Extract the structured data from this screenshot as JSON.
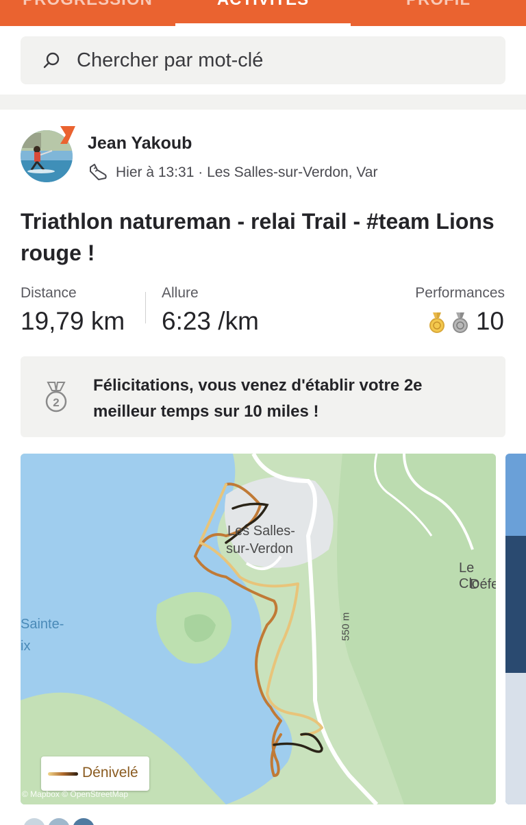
{
  "tabs": [
    "PROGRESSION",
    "ACTIVITÉS",
    "PROFIL"
  ],
  "search": {
    "placeholder": "Chercher par mot-clé",
    "icon": "search-icon"
  },
  "activity": {
    "athlete": "Jean Yakoub",
    "meta": "Hier à 13:31 · Les Salles-sur-Verdon, Var",
    "type_icon": "shoe-icon",
    "title": "Triathlon natureman - relai Trail - #team Lions rouge !",
    "stats": {
      "distance_label": "Distance",
      "distance_value": "19,79 km",
      "pace_label": "Allure",
      "pace_value": "6:23 /km",
      "perf_label": "Performances",
      "perf_count": "10"
    },
    "congrats": "Félicitations, vous venez d'établir votre 2e meilleur temps sur 10 miles !",
    "congrats_medal_number": "2"
  },
  "map": {
    "legend_label": "Dénivelé",
    "attribution": "© Mapbox © OpenStreetMap",
    "labels": {
      "town": "Les Salles-",
      "town2": "sur-Verdon",
      "elevation": "550 m",
      "lake1": "Sainte-",
      "lake2": "ix",
      "place1": "Le Clo",
      "place2": "Défe"
    }
  },
  "colors": {
    "accent": "#ea6330",
    "gold": "#f0b429",
    "silver": "#9a9a9a"
  }
}
